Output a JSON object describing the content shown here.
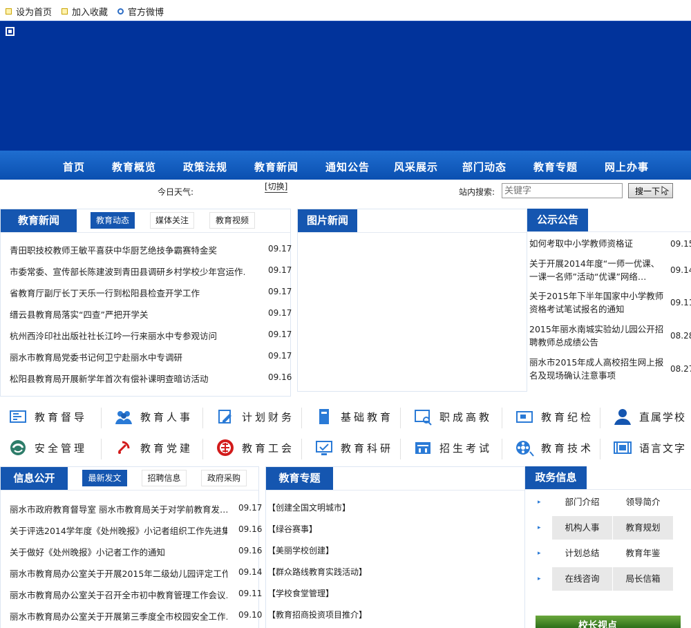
{
  "topbar": {
    "sethome": "设为首页",
    "favorite": "加入收藏",
    "weibo": "官方微博"
  },
  "nav": {
    "items": [
      "首页",
      "教育概览",
      "政策法规",
      "教育新闻",
      "通知公告",
      "风采展示",
      "部门动态",
      "教育专题",
      "网上办事"
    ]
  },
  "weather": {
    "label": "今日天气:",
    "switch": "[切换]"
  },
  "search": {
    "label": "站内搜索:",
    "placeholder": "关键字",
    "button": "搜一下"
  },
  "news": {
    "title": "教育新闻",
    "tabs": [
      "教育动态",
      "媒体关注",
      "教育视频"
    ],
    "items": [
      {
        "text": "青田职技校教师王敏平喜获中华厨艺绝技争霸赛特金奖",
        "date": "09.17"
      },
      {
        "text": "市委常委、宣传部长陈建波到青田县调研乡村学校少年宫运作…",
        "date": "09.17"
      },
      {
        "text": "省教育厅副厅长丁天乐一行到松阳县检查开学工作",
        "date": "09.17"
      },
      {
        "text": "缙云县教育局落实“四查”严把开学关",
        "date": "09.17"
      },
      {
        "text": "杭州西泠印社出版社社长江吟一行来丽水中专参观访问",
        "date": "09.17"
      },
      {
        "text": "丽水市教育局党委书记何卫宁赴丽水中专调研",
        "date": "09.17"
      },
      {
        "text": "松阳县教育局开展新学年首次有偿补课明查暗访活动",
        "date": "09.16"
      }
    ]
  },
  "photo": {
    "title": "图片新闻"
  },
  "notice": {
    "title": "公示公告",
    "items": [
      {
        "text": "如何考取中小学教师资格证",
        "date": "09.15"
      },
      {
        "text": "关于开展2014年度“一师一优课、一课一名师”活动“优课”网络…",
        "date": "09.14"
      },
      {
        "text": "关于2015年下半年国家中小学教师资格考试笔试报名的通知",
        "date": "09.11"
      },
      {
        "text": "2015年丽水南城实验幼儿园公开招聘教师总成绩公告",
        "date": "08.28"
      },
      {
        "text": "丽水市2015年成人高校招生网上报名及现场确认注意事项",
        "date": "08.27"
      }
    ]
  },
  "categories": [
    [
      "教育督导",
      "教育人事",
      "计划财务",
      "基础教育",
      "职成高教",
      "教育纪检",
      "直属学校"
    ],
    [
      "安全管理",
      "教育党建",
      "教育工会",
      "教育科研",
      "招生考试",
      "教育技术",
      "语言文字"
    ]
  ],
  "info": {
    "title": "信息公开",
    "tabs": [
      "最新发文",
      "招聘信息",
      "政府采购"
    ],
    "items": [
      {
        "text": "丽水市政府教育督导室 丽水市教育局关于对学前教育发…",
        "date": "09.17"
      },
      {
        "text": "关于评选2014学年度《处州晚报》小记者组织工作先进集…",
        "date": "09.16"
      },
      {
        "text": "关于做好《处州晚报》小记者工作的通知",
        "date": "09.16"
      },
      {
        "text": "丽水市教育局办公室关于开展2015年二级幼儿园评定工作…",
        "date": "09.14"
      },
      {
        "text": "丽水市教育局办公室关于召开全市初中教育管理工作会议…",
        "date": "09.11"
      },
      {
        "text": "丽水市教育局办公室关于开展第三季度全市校园安全工作…",
        "date": "09.10"
      }
    ]
  },
  "topics": {
    "title": "教育专题",
    "items": [
      "【创建全国文明城市】",
      "【绿谷赛事】",
      "【美丽学校创建】",
      "【群众路线教育实践活动】",
      "【学校食堂管理】",
      "【教育招商投资项目推介】"
    ]
  },
  "gov": {
    "title": "政务信息",
    "cells": [
      [
        "部门介绍",
        "领导简介"
      ],
      [
        "机构人事",
        "教育规划"
      ],
      [
        "计划总结",
        "教育年鉴"
      ],
      [
        "在线咨询",
        "局长信箱"
      ]
    ]
  },
  "promo": {
    "label": "校长视点"
  },
  "colors": {
    "nav": "#1556b0",
    "banner": "#01339b",
    "accent": "#2a7ad6"
  }
}
